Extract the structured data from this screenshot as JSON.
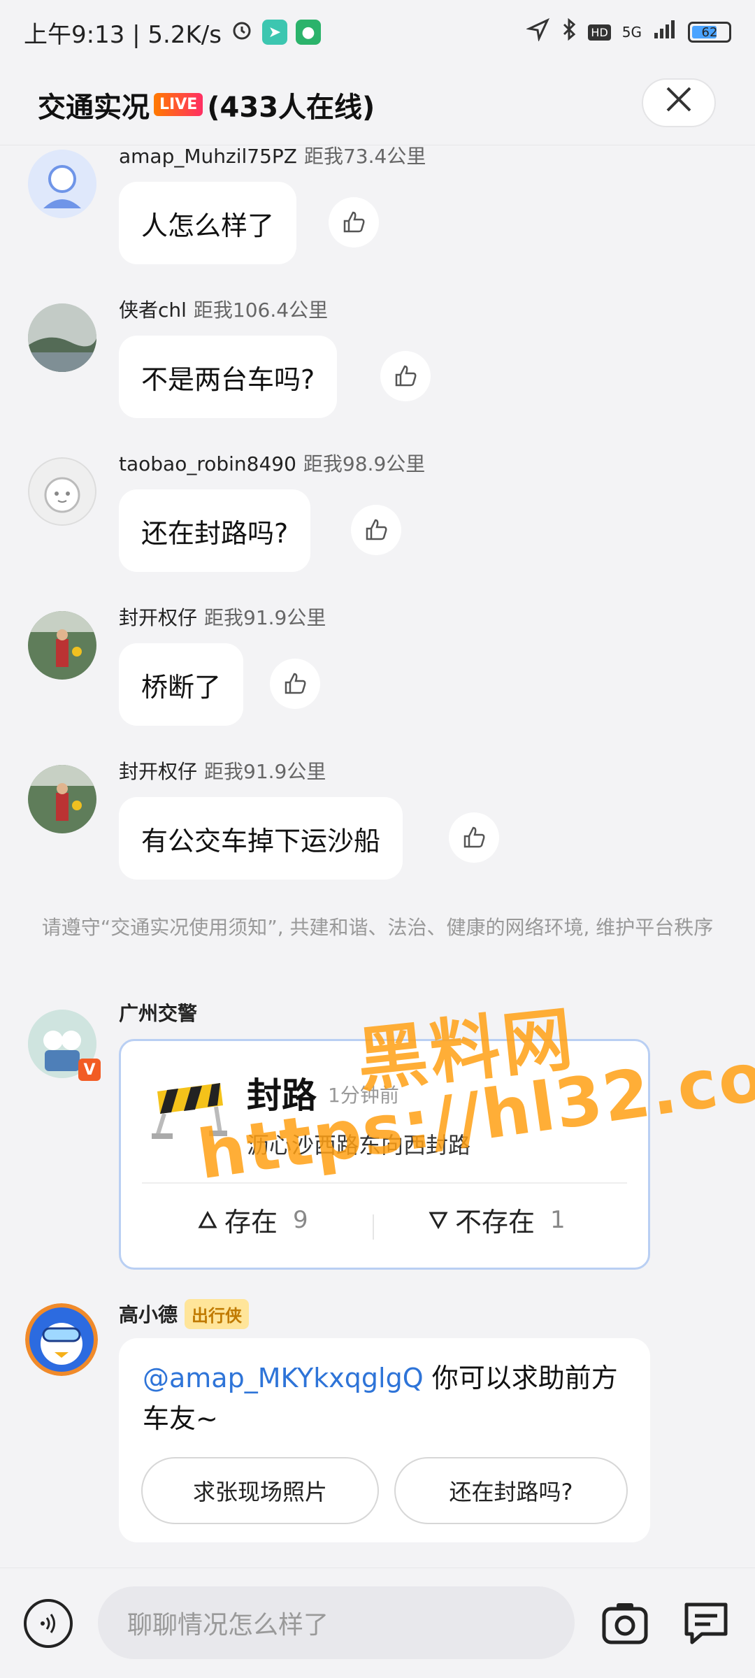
{
  "status_bar": {
    "left_text": "上午9:13 | 5.2K/s",
    "network": "5G",
    "battery": "62",
    "icons": [
      "alarm-icon",
      "app-icon",
      "shield-app-icon",
      "location-icon",
      "bluetooth-icon",
      "hd-icon",
      "signal-icon",
      "battery-icon"
    ]
  },
  "header": {
    "title_prefix": "交通实况",
    "live_badge": "LIVE",
    "title_suffix": "(433人在线)",
    "close_icon": "close-icon"
  },
  "messages": [
    {
      "user": "amap_Muhzil75PZ",
      "distance": "距我73.4公里",
      "text": "人怎么样了",
      "avatar": "default-avatar-icon"
    },
    {
      "user": "侠者chl",
      "distance": "距我106.4公里",
      "text": "不是两台车吗?",
      "avatar": "landscape-avatar"
    },
    {
      "user": "taobao_robin8490",
      "distance": "距我98.9公里",
      "text": "还在封路吗?",
      "avatar": "mascot-avatar"
    },
    {
      "user": "封开权仔",
      "distance": "距我91.9公里",
      "text": "桥断了",
      "avatar": "photo-avatar"
    },
    {
      "user": "封开权仔",
      "distance": "距我91.9公里",
      "text": "有公交车掉下运沙船",
      "avatar": "photo-avatar"
    }
  ],
  "notice": "请遵守“交通实况使用须知”, 共建和谐、法治、健康的网络环境, 维护平台秩序",
  "traffic_card": {
    "poster": "广州交警",
    "title": "封路",
    "time": "1分钟前",
    "description": "沥心沙西路东向西封路",
    "vote_yes_label": "存在",
    "vote_yes_count": "9",
    "vote_no_label": "不存在",
    "vote_no_count": "1"
  },
  "bot": {
    "name": "高小德",
    "badge": "出行侠",
    "mention": "@amap_MKYkxqglgQ",
    "text": " 你可以求助前方车友~",
    "quick_replies": [
      "求张现场照片",
      "还在封路吗?"
    ]
  },
  "input_bar": {
    "placeholder": "聊聊情况怎么样了",
    "icons": [
      "voice-icon",
      "camera-icon",
      "chat-icon"
    ]
  },
  "watermark": {
    "line1": "黑料网",
    "line2": "https://hl32.co"
  },
  "colors": {
    "accent_blue": "#2e74d8",
    "card_border": "#b9cff3",
    "watermark": "#ffa014"
  }
}
